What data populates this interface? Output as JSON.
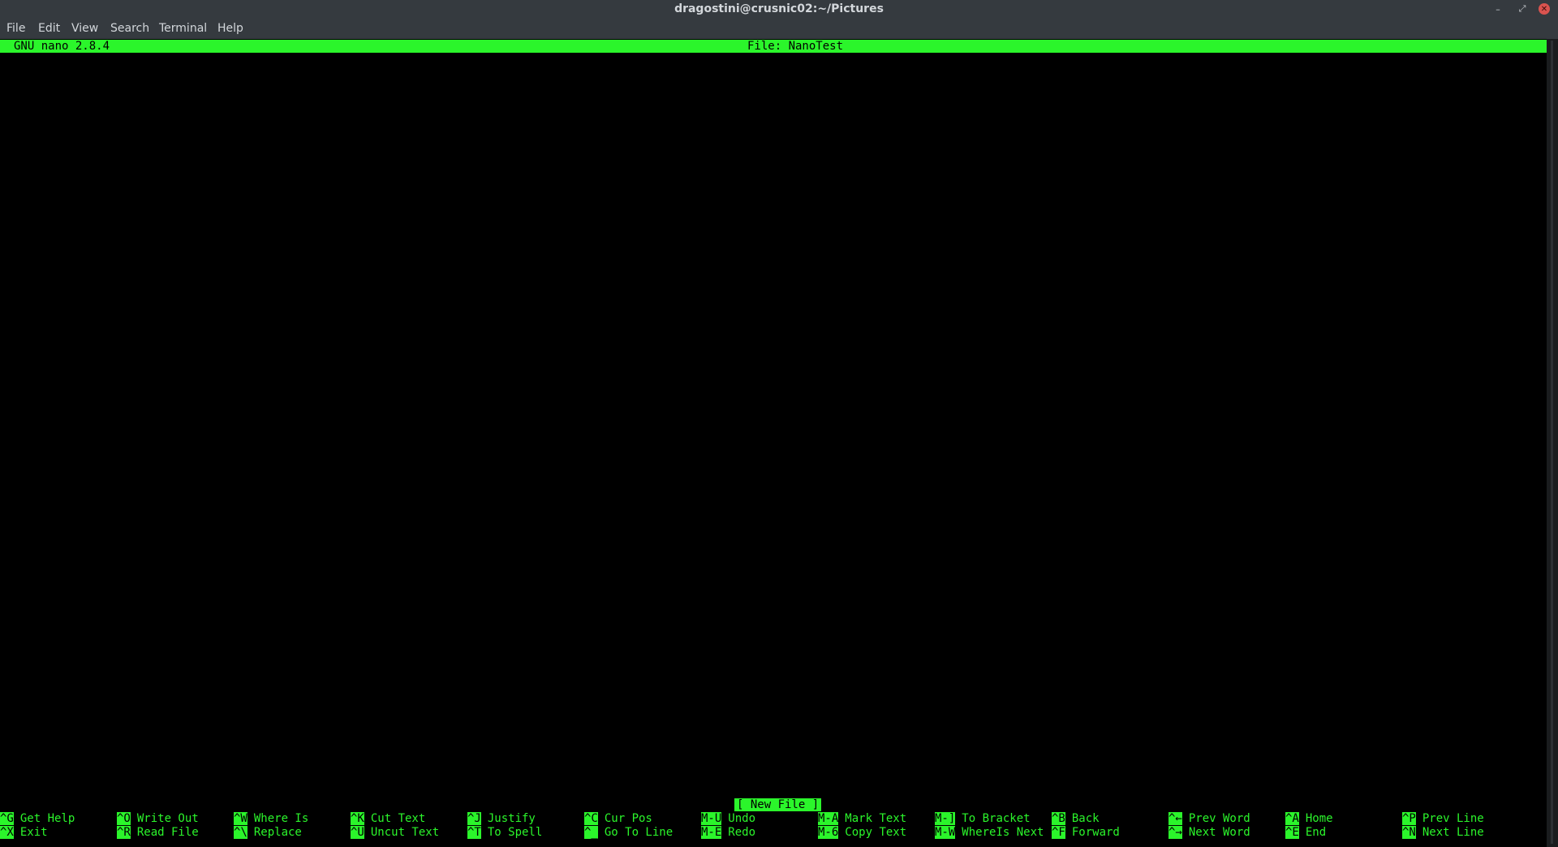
{
  "window": {
    "title": "dragostini@crusnic02:~/Pictures",
    "controls": {
      "minimize": "–",
      "maximize": "⤢",
      "close": "✕"
    }
  },
  "menu": [
    "File",
    "Edit",
    "View",
    "Search",
    "Terminal",
    "Help"
  ],
  "nano": {
    "version": "GNU nano 2.8.4",
    "file": "File: NanoTest",
    "status": "[ New File ]"
  },
  "shortcuts": [
    {
      "key": "^G",
      "label": "Get Help"
    },
    {
      "key": "^X",
      "label": "Exit"
    },
    {
      "key": "^O",
      "label": "Write Out"
    },
    {
      "key": "^R",
      "label": "Read File"
    },
    {
      "key": "^W",
      "label": "Where Is"
    },
    {
      "key": "^\\",
      "label": "Replace"
    },
    {
      "key": "^K",
      "label": "Cut Text"
    },
    {
      "key": "^U",
      "label": "Uncut Text"
    },
    {
      "key": "^J",
      "label": "Justify"
    },
    {
      "key": "^T",
      "label": "To Spell"
    },
    {
      "key": "^C",
      "label": "Cur Pos"
    },
    {
      "key": "^_",
      "label": "Go To Line"
    },
    {
      "key": "M-U",
      "label": "Undo"
    },
    {
      "key": "M-E",
      "label": "Redo"
    },
    {
      "key": "M-A",
      "label": "Mark Text"
    },
    {
      "key": "M-6",
      "label": "Copy Text"
    },
    {
      "key": "M-]",
      "label": "To Bracket"
    },
    {
      "key": "M-W",
      "label": "WhereIs Next"
    },
    {
      "key": "^B",
      "label": "Back"
    },
    {
      "key": "^F",
      "label": "Forward"
    },
    {
      "key": "^←",
      "label": "Prev Word"
    },
    {
      "key": "^→",
      "label": "Next Word"
    },
    {
      "key": "^A",
      "label": "Home"
    },
    {
      "key": "^E",
      "label": "End"
    },
    {
      "key": "^P",
      "label": "Prev Line"
    },
    {
      "key": "^N",
      "label": "Next Line"
    }
  ],
  "colors": {
    "terminal_fg": "#2bf52b",
    "terminal_bg": "#000000",
    "chrome_bg": "#353a3f",
    "close_button": "#d9534f"
  }
}
